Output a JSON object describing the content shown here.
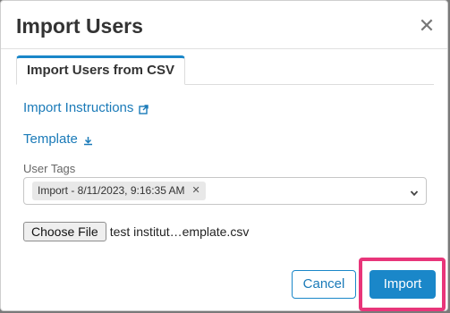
{
  "dialog": {
    "title": "Import Users",
    "close_icon": "close-icon"
  },
  "tabs": [
    {
      "label": "Import Users from CSV",
      "active": true
    }
  ],
  "links": {
    "instructions": {
      "label": "Import Instructions",
      "icon": "external-link-icon"
    },
    "template": {
      "label": "Template",
      "icon": "download-icon"
    }
  },
  "user_tags": {
    "label": "User Tags",
    "selected_tags": [
      {
        "label": "Import - 8/11/2023, 9:16:35 AM"
      }
    ]
  },
  "file_input": {
    "button_label": "Choose File",
    "file_name": "test institut…emplate.csv"
  },
  "footer": {
    "cancel_label": "Cancel",
    "import_label": "Import"
  },
  "colors": {
    "accent": "#1a87c9",
    "link": "#1a7ab8",
    "highlight": "#e8357a"
  }
}
